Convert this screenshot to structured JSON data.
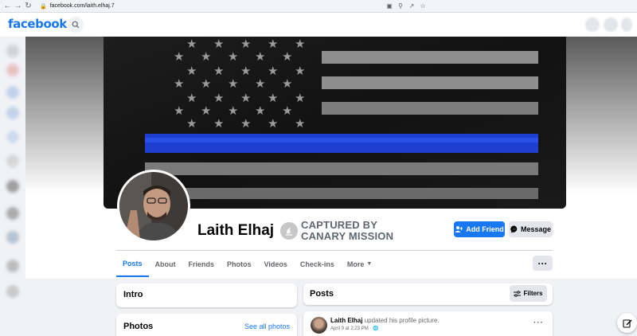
{
  "browser": {
    "url": "facebook.com/laith.elhaj.7",
    "icons": [
      "back-icon",
      "forward-icon",
      "reload-icon",
      "lock-icon",
      "cast-icon",
      "zoom-icon",
      "share-icon",
      "star-icon"
    ]
  },
  "header": {
    "logo": "facebook"
  },
  "profile": {
    "name": "Laith Elhaj",
    "badge_line1": "CAPTURED BY",
    "badge_line2": "CANARY MISSION",
    "add_friend_label": "Add Friend",
    "message_label": "Message",
    "more_label": "···"
  },
  "tabs": [
    {
      "label": "Posts",
      "active": true
    },
    {
      "label": "About"
    },
    {
      "label": "Friends"
    },
    {
      "label": "Photos"
    },
    {
      "label": "Videos"
    },
    {
      "label": "Check-ins"
    },
    {
      "label": "More"
    }
  ],
  "intro": {
    "title": "Intro"
  },
  "photos": {
    "title": "Photos",
    "see_all": "See all photos"
  },
  "posts": {
    "title": "Posts",
    "filters_label": "Filters",
    "first_post": {
      "author": "Laith Elhaj",
      "action": "updated his profile picture.",
      "date": "April 9 at 2:23 PM ·"
    }
  },
  "colors": {
    "accent": "#1877f2",
    "thin_blue_line": "#1f3fd0"
  }
}
